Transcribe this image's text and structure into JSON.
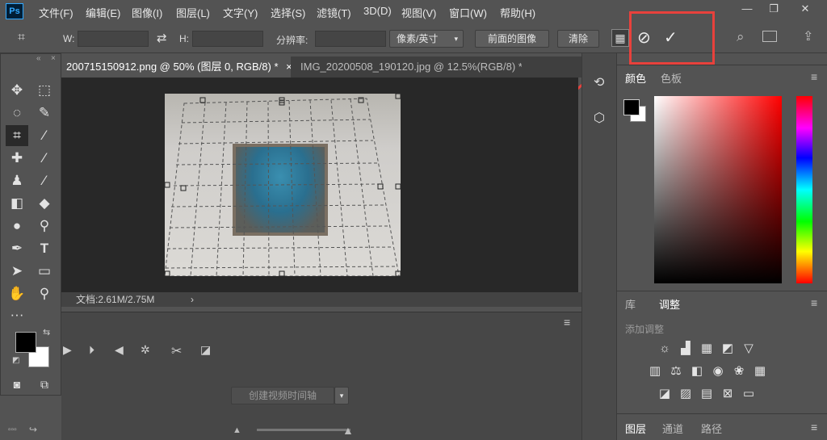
{
  "app_logo": "Ps",
  "menu": [
    "文件(F)",
    "编辑(E)",
    "图像(I)",
    "图层(L)",
    "文字(Y)",
    "选择(S)",
    "滤镜(T)",
    "3D(D)",
    "视图(V)",
    "窗口(W)",
    "帮助(H)"
  ],
  "window_controls": {
    "minimize": "—",
    "restore": "❐",
    "close": "✕"
  },
  "options": {
    "w_label": "W:",
    "h_label": "H:",
    "swap_icon": "⇄",
    "resolution_label": "分辨率:",
    "unit_select": "像素/英寸",
    "front_image": "前面的图像",
    "clear": "清除",
    "cancel_icon": "⊘",
    "commit_icon": "✓"
  },
  "tabs": [
    {
      "label": "200715150912.png @ 50% (图层 0, RGB/8) *",
      "close": "×"
    },
    {
      "label": "IMG_20200508_190120.jpg @ 12.5%(RGB/8) *",
      "close": "×"
    }
  ],
  "status": {
    "doc_size": "文档:2.61M/2.75M",
    "arrow": "›"
  },
  "timeline": {
    "create_button": "创建视频时间轴"
  },
  "color_panel": {
    "tabs": [
      "颜色",
      "色板"
    ],
    "foreground": "#000000",
    "background": "#ffffff"
  },
  "adjust_panel": {
    "tabs": [
      "库",
      "调整"
    ],
    "add_label": "添加调整"
  },
  "layers_panel": {
    "tabs": [
      "图层",
      "通道",
      "路径"
    ]
  },
  "accent_color": "#e8413c"
}
